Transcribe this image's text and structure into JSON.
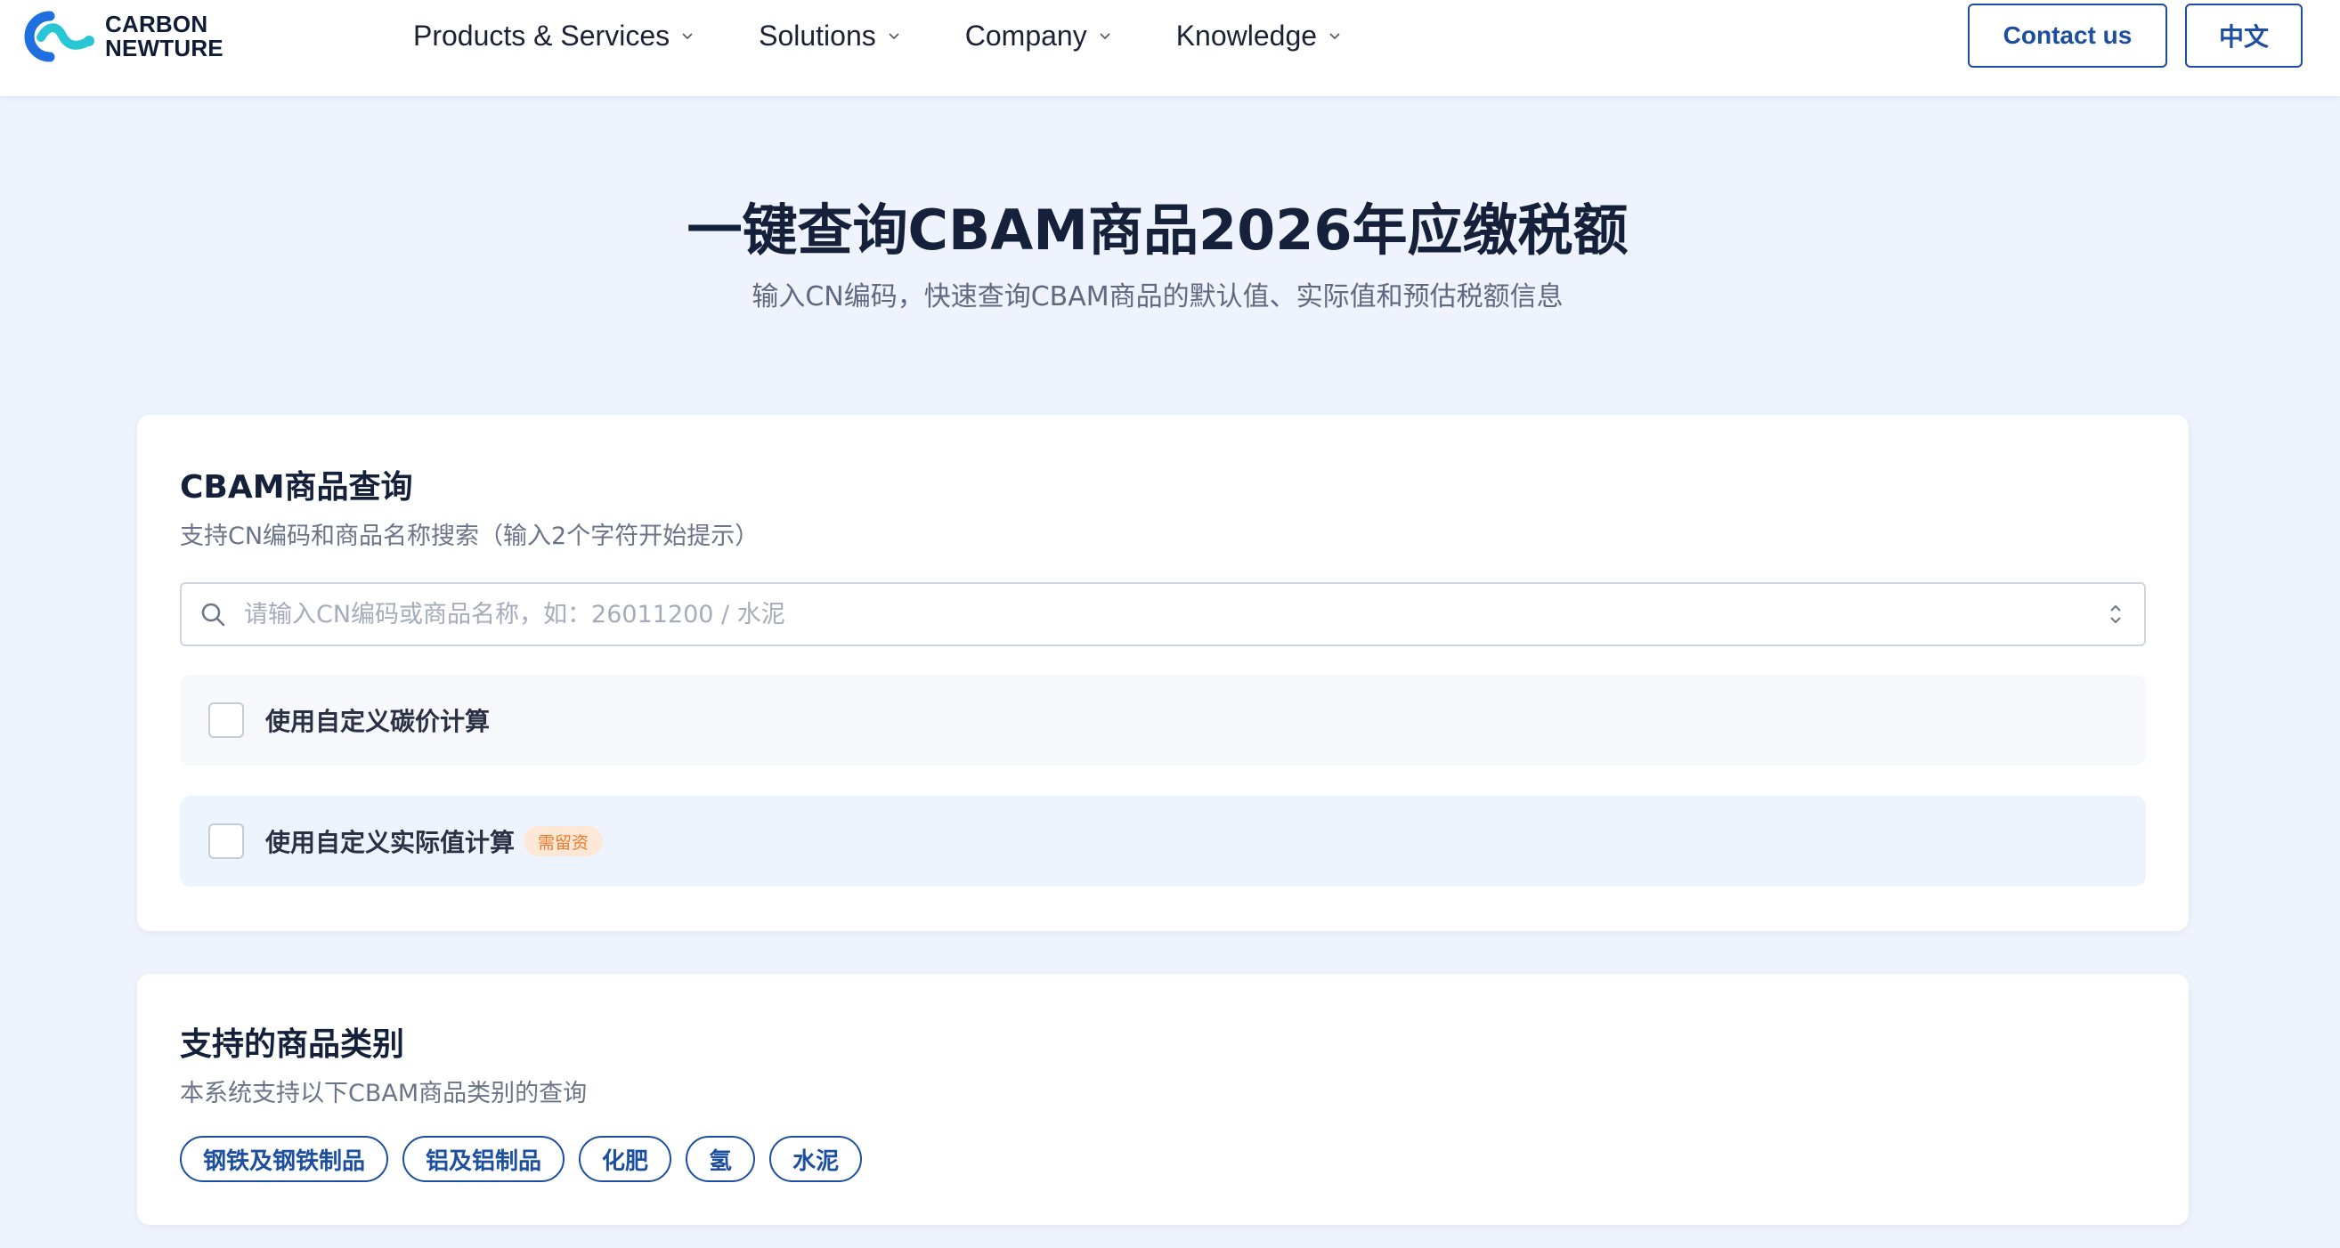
{
  "header": {
    "logo": {
      "line1": "CARBON",
      "line2": "NEWTURE"
    },
    "nav": [
      {
        "label": "Products & Services"
      },
      {
        "label": "Solutions"
      },
      {
        "label": "Company"
      },
      {
        "label": "Knowledge"
      }
    ],
    "contact_label": "Contact us",
    "language_label": "中文"
  },
  "hero": {
    "title": "一键查询CBAM商品2026年应缴税额",
    "subtitle": "输入CN编码，快速查询CBAM商品的默认值、实际值和预估税额信息"
  },
  "query_card": {
    "title": "CBAM商品查询",
    "description": "支持CN编码和商品名称搜索（输入2个字符开始提示）",
    "search": {
      "placeholder": "请输入CN编码或商品名称，如：26011200 / 水泥",
      "value": ""
    },
    "options": [
      {
        "label": "使用自定义碳价计算",
        "checked": false
      },
      {
        "label": "使用自定义实际值计算",
        "badge": "需留资",
        "checked": false
      }
    ]
  },
  "categories_card": {
    "title": "支持的商品类别",
    "description": "本系统支持以下CBAM商品类别的查询",
    "tags": [
      "钢铁及钢铁制品",
      "铝及铝制品",
      "化肥",
      "氢",
      "水泥"
    ]
  },
  "colors": {
    "brand_blue": "#1d4fa0",
    "logo_blue": "#1f6fe0",
    "logo_cyan": "#29c6d6",
    "background": "#eef3fd",
    "badge_bg": "#fde8d8",
    "badge_text": "#f07a2a"
  }
}
